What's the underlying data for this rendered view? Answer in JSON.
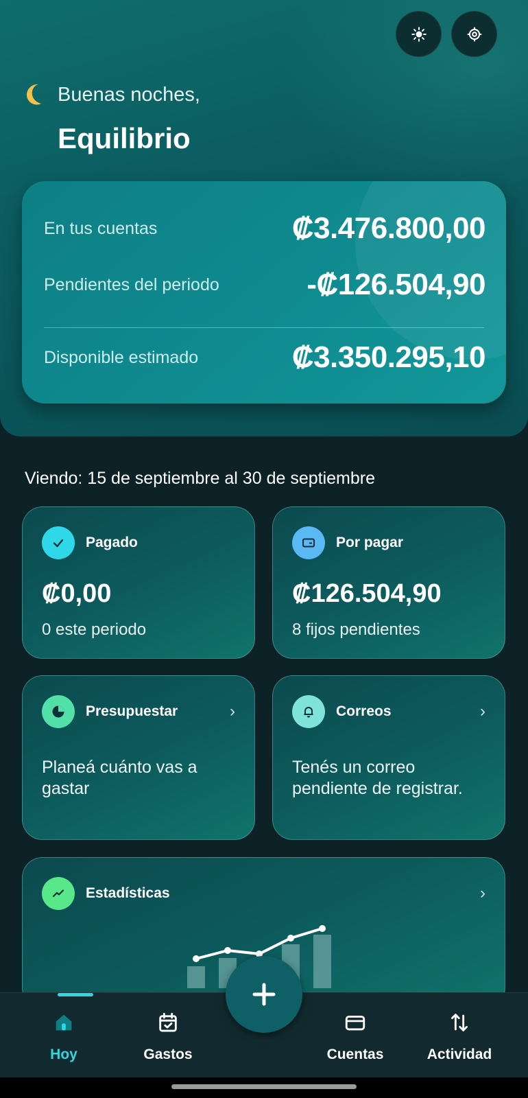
{
  "header": {
    "greeting": "Buenas noches,",
    "app_name": "Equilibrio",
    "icons": {
      "theme": "sun-icon",
      "settings": "gear-icon",
      "moon": "moon-icon"
    }
  },
  "balance": {
    "accounts_label": "En tus cuentas",
    "accounts_value": "₡3.476.800,00",
    "pending_label": "Pendientes del periodo",
    "pending_value": "-₡126.504,90",
    "available_label": "Disponible estimado",
    "available_value": "₡3.350.295,10"
  },
  "period_text": "Viendo: 15 de septiembre al 30 de septiembre",
  "cards": {
    "paid": {
      "title": "Pagado",
      "amount": "₡0,00",
      "subtitle": "0 este periodo",
      "icon": "check-icon",
      "color": "#2fd8e8"
    },
    "to_pay": {
      "title": "Por pagar",
      "amount": "₡126.504,90",
      "subtitle": "8 fijos pendientes",
      "icon": "card-icon",
      "color": "#5ab8f5"
    },
    "budget": {
      "title": "Presupuestar",
      "description": "Planeá cuánto vas a gastar",
      "icon": "pie-chart-icon",
      "color": "#52e0a8"
    },
    "emails": {
      "title": "Correos",
      "description": "Tenés un correo pendiente de registrar.",
      "icon": "bell-icon",
      "color": "#7fe3dc"
    },
    "stats": {
      "title": "Estadísticas",
      "icon": "trend-icon",
      "color": "#58e88a"
    }
  },
  "nav": {
    "items": [
      {
        "label": "Hoy",
        "icon": "home-icon",
        "active": true
      },
      {
        "label": "Gastos",
        "icon": "calendar-check-icon"
      },
      {
        "label": "Cuentas",
        "icon": "credit-card-icon"
      },
      {
        "label": "Actividad",
        "icon": "arrows-updown-icon"
      }
    ],
    "fab_icon": "plus-icon",
    "active_color": "#2fd8e0"
  }
}
